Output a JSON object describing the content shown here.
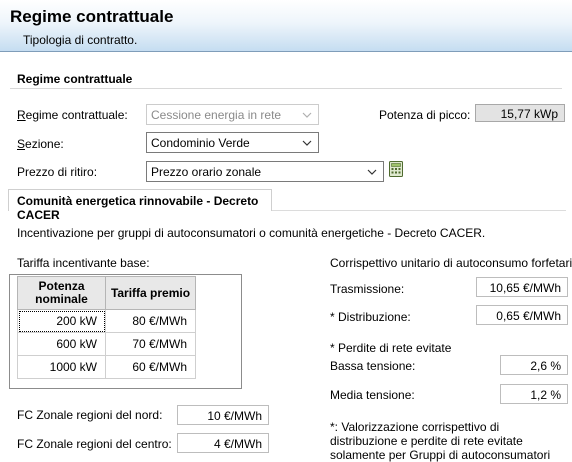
{
  "header": {
    "title": "Regime contrattuale",
    "subtitle": "Tipologia di contratto."
  },
  "section": {
    "title": "Regime contrattuale",
    "regime_label": "Regime contrattuale:",
    "regime_value": "Cessione energia in rete",
    "sezione_label": "Sezione:",
    "sezione_value": "Condominio Verde",
    "prezzo_label": "Prezzo di ritiro:",
    "prezzo_value": "Prezzo orario zonale",
    "potenza_label": "Potenza di picco:",
    "potenza_value": "15,77 kWp"
  },
  "tab": {
    "label": "Comunità energetica rinnovabile - Decreto CACER"
  },
  "cacer": {
    "description": "Incentivazione per gruppi di autoconsumatori o comunità energetiche - Decreto CACER.",
    "tariffa_title": "Tariffa incentivante base:",
    "table_headers": [
      "Potenza nominale",
      "Tariffa premio"
    ],
    "table_rows": [
      [
        "200 kW",
        "80 €/MWh"
      ],
      [
        "600 kW",
        "70 €/MWh"
      ],
      [
        "1000 kW",
        "60 €/MWh"
      ]
    ],
    "fc_nord_label": "FC Zonale regioni del nord:",
    "fc_nord_value": "10 €/MWh",
    "fc_centro_label": "FC Zonale regioni del centro:",
    "fc_centro_value": "4 €/MWh",
    "corrispettivo_title": "Corrispettivo unitario di autoconsumo forfetario",
    "trasmissione_label": "Trasmissione:",
    "trasmissione_value": "10,65 €/MWh",
    "distribuzione_label": "* Distribuzione:",
    "distribuzione_value": "0,65 €/MWh",
    "perdite_label": "* Perdite di rete evitate",
    "bassa_label": "Bassa tensione:",
    "bassa_value": "2,6 %",
    "media_label": "Media tensione:",
    "media_value": "1,2 %",
    "note": "*: Valorizzazione corrispettivo di distribuzione e perdite di rete evitate solamente per Gruppi di autoconsumatori"
  },
  "icons": {
    "combo_arrow": "chevron-down-icon",
    "calculator": "calculator-icon"
  }
}
